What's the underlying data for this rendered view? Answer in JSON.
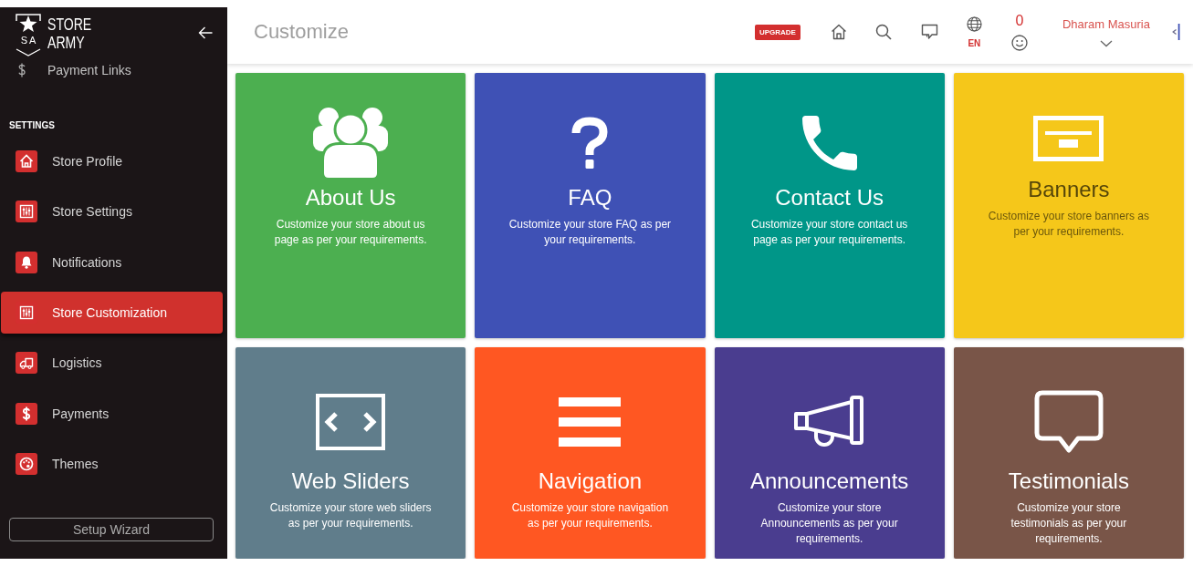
{
  "sidebar": {
    "brand": {
      "monogram": "SA",
      "name": "STORE ARMY"
    },
    "links": [
      {
        "label": "Payment Links"
      }
    ],
    "section_title": "SETTINGS",
    "items": [
      {
        "label": "Store Profile",
        "selected": false
      },
      {
        "label": "Store Settings",
        "selected": false
      },
      {
        "label": "Notifications",
        "selected": false
      },
      {
        "label": "Store Customization",
        "selected": true
      },
      {
        "label": "Logistics",
        "selected": false
      },
      {
        "label": "Payments",
        "selected": false
      },
      {
        "label": "Themes",
        "selected": false
      }
    ],
    "setup_button": "Setup Wizard"
  },
  "header": {
    "title": "Customize",
    "upgrade_badge": "UPGRADE",
    "language": "EN",
    "notification_count": "0",
    "user_name": "Dharam Masuria"
  },
  "cards": [
    {
      "title": "About Us",
      "description": "Customize your store about us page as per your requirements.",
      "color": "#4caf50"
    },
    {
      "title": "FAQ",
      "description": "Customize your store FAQ as per your requirements.",
      "color": "#3f51b5"
    },
    {
      "title": "Contact Us",
      "description": "Customize your store contact us page as per your requirements.",
      "color": "#009688"
    },
    {
      "title": "Banners",
      "description": "Customize your store banners as per your requirements.",
      "color": "#f5c71a"
    },
    {
      "title": "Web Sliders",
      "description": "Customize your store web sliders as per your requirements.",
      "color": "#607d8b"
    },
    {
      "title": "Navigation",
      "description": "Customize your store navigation as per your requirements.",
      "color": "#ff5722"
    },
    {
      "title": "Announcements",
      "description": "Customize your store Announcements as per your requirements.",
      "color": "#4a3d8f"
    },
    {
      "title": "Testimonials",
      "description": "Customize your store testimonials as per your requirements.",
      "color": "#795548"
    }
  ]
}
